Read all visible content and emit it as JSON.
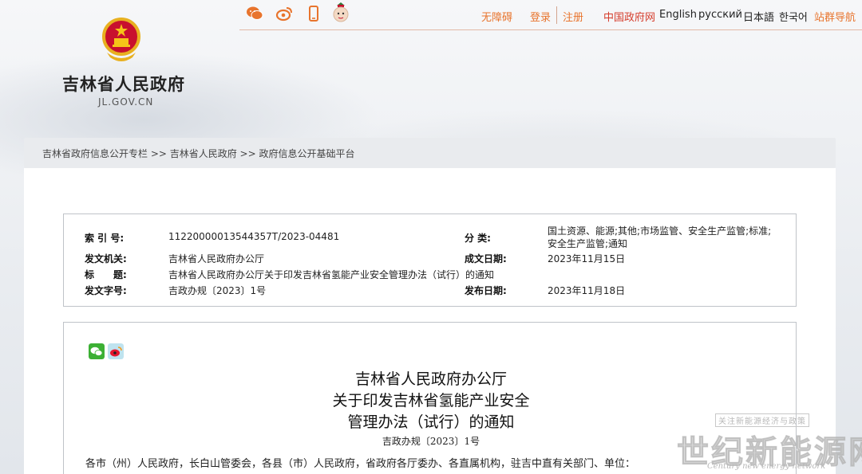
{
  "header": {
    "site_title": "吉林省人民政府",
    "site_domain": "JL.GOV.CN",
    "social_icons": [
      "wechat-icon",
      "weibo-icon",
      "mobile-icon",
      "mascot-icon"
    ],
    "links": {
      "accessibility": "无障碍",
      "login": "登录",
      "register": "注册",
      "china_gov": "中国政府网",
      "english": "English",
      "russian": "русский",
      "japanese": "日本語",
      "korean": "한국어",
      "site_nav": "站群导航"
    },
    "colors": {
      "accent": "#e8742d",
      "red": "#d53c2b"
    }
  },
  "breadcrumb": {
    "text": "吉林省政府信息公开专栏 >> 吉林省人民政府 >> 政府信息公开基础平台"
  },
  "meta": {
    "index_label": "索 引 号:",
    "index_value": "11220000013544357T/2023-04481",
    "category_label": "分 类:",
    "category_value": "国土资源、能源;其他;市场监管、安全生产监管;标准;安全生产监管;通知",
    "issuer_label": "发文机关:",
    "issuer_value": "吉林省人民政府办公厅",
    "created_label": "成文日期:",
    "created_value": "2023年11月15日",
    "title_label": "标　　题:",
    "title_value": "吉林省人民政府办公厅关于印发吉林省氢能产业安全管理办法（试行）的通知",
    "docno_label": "发文字号:",
    "docno_value": "吉政办规〔2023〕1号",
    "published_label": "发布日期:",
    "published_value": "2023年11月18日"
  },
  "document": {
    "title_line1": "吉林省人民政府办公厅",
    "title_line2": "关于印发吉林省氢能产业安全",
    "title_line3": "管理办法（试行）的通知",
    "doc_number": "吉政办规〔2023〕1号",
    "first_paragraph": "各市（州）人民政府，长白山管委会，各县（市）人民政府，省政府各厅委办、各直属机构，驻吉中直有关部门、单位："
  },
  "watermark": {
    "tag": "关注新能源经济与政策",
    "main": "世纪新能源网",
    "sub": "Century new energy network"
  }
}
